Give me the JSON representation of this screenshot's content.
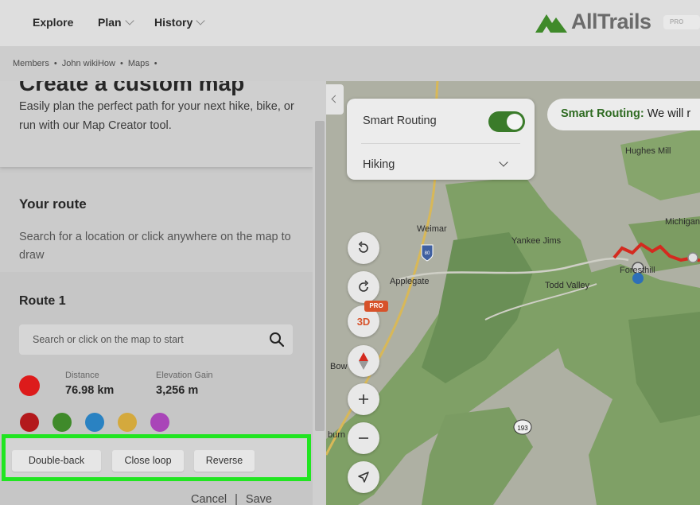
{
  "header": {
    "nav": [
      "Explore",
      "Plan",
      "History"
    ],
    "brand": "AllTrails",
    "badge": "PRO"
  },
  "breadcrumb": [
    "Members",
    "John wikiHow",
    "Maps"
  ],
  "sidebar": {
    "title": "Create a custom map",
    "description": "Easily plan the perfect path for your next hike, bike, or run with our Map Creator tool.",
    "your_route_heading": "Your route",
    "your_route_hint": "Search for a location or click anywhere on the map to draw",
    "route_name": "Route 1",
    "search_placeholder": "Search or click on the map to start",
    "distance_label": "Distance",
    "distance_value": "76.98 km",
    "elevation_label": "Elevation Gain",
    "elevation_value": "3,256 m",
    "route_color": "#dd1b1b",
    "color_options": [
      "#b3191c",
      "#3f8a2a",
      "#2a82c2",
      "#d4a93d",
      "#a945b8"
    ],
    "actions": [
      "Double-back",
      "Close loop",
      "Reverse"
    ],
    "cancel": "Cancel",
    "save": "Save"
  },
  "map": {
    "smart_routing_label": "Smart Routing",
    "smart_routing_on": true,
    "activity": "Hiking",
    "tooltip_bold": "Smart Routing:",
    "tooltip_text": " We will r",
    "pro_tag": "PRO",
    "btn_3d": "3D",
    "highway_shield": "80",
    "road_193": "193",
    "places": {
      "hughes_mill": "Hughes Mill",
      "michigan": "Michigan",
      "weimar": "Weimar",
      "yankee_jims": "Yankee Jims",
      "foresthill": "Foresthill",
      "applegate": "Applegate",
      "todd_valley": "Todd Valley",
      "bowman": "Bow",
      "auburn": "burn"
    }
  }
}
